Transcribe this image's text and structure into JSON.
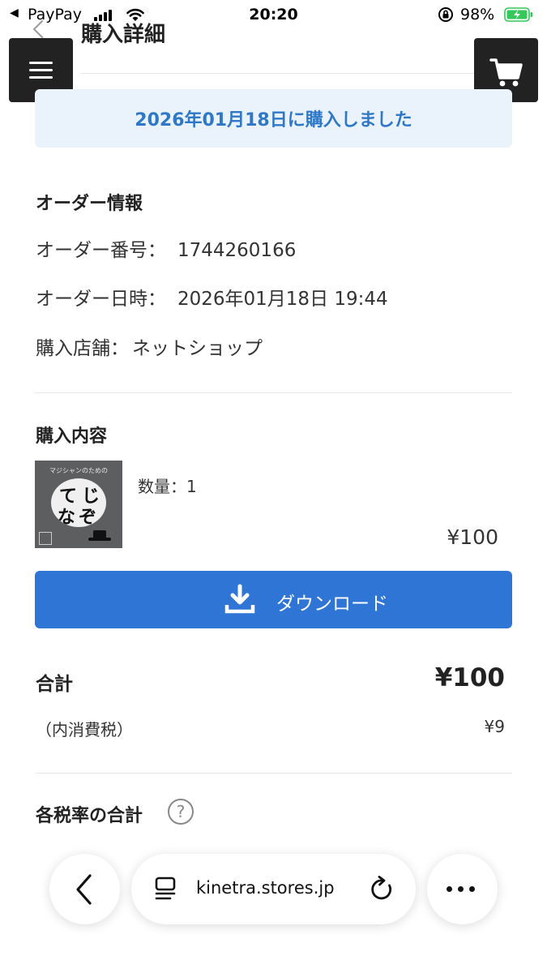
{
  "status_bar": {
    "back_label": "◀",
    "carrier": "PayPay",
    "time": "20:20",
    "battery": "98%"
  },
  "header": {
    "page_title": "購入詳細"
  },
  "notice": {
    "purchased_text": "2026年01月18日に購入しました"
  },
  "order_info": {
    "heading": "オーダー情報",
    "number_label": "オーダー番号：",
    "number_value": "1744260166",
    "datetime_label": "オーダー日時：",
    "datetime_value": "2026年01月18日 19:44",
    "store_label": "購入店舗：",
    "store_value": "ネットショップ"
  },
  "purchase": {
    "heading": "購入内容",
    "item": {
      "thumb_tagline": "マジシャンのための",
      "thumb_title_line1": "てじ",
      "thumb_title_line2": "なぞ",
      "quantity": "数量：1",
      "price": "¥100"
    },
    "download_label": "ダウンロード"
  },
  "totals": {
    "total_label": "合計",
    "total_value": "¥100",
    "tax_label": "（内消費税）",
    "tax_value": "¥9",
    "rates_label": "各税率の合計",
    "help_symbol": "?"
  },
  "browser": {
    "url": "kinetra.stores.jp"
  },
  "colors": {
    "accent_blue": "#2f75d5",
    "notice_bg": "#eaf2fb",
    "notice_text": "#2f78c8",
    "header_button_bg": "#222222",
    "battery_green": "#34c759"
  }
}
